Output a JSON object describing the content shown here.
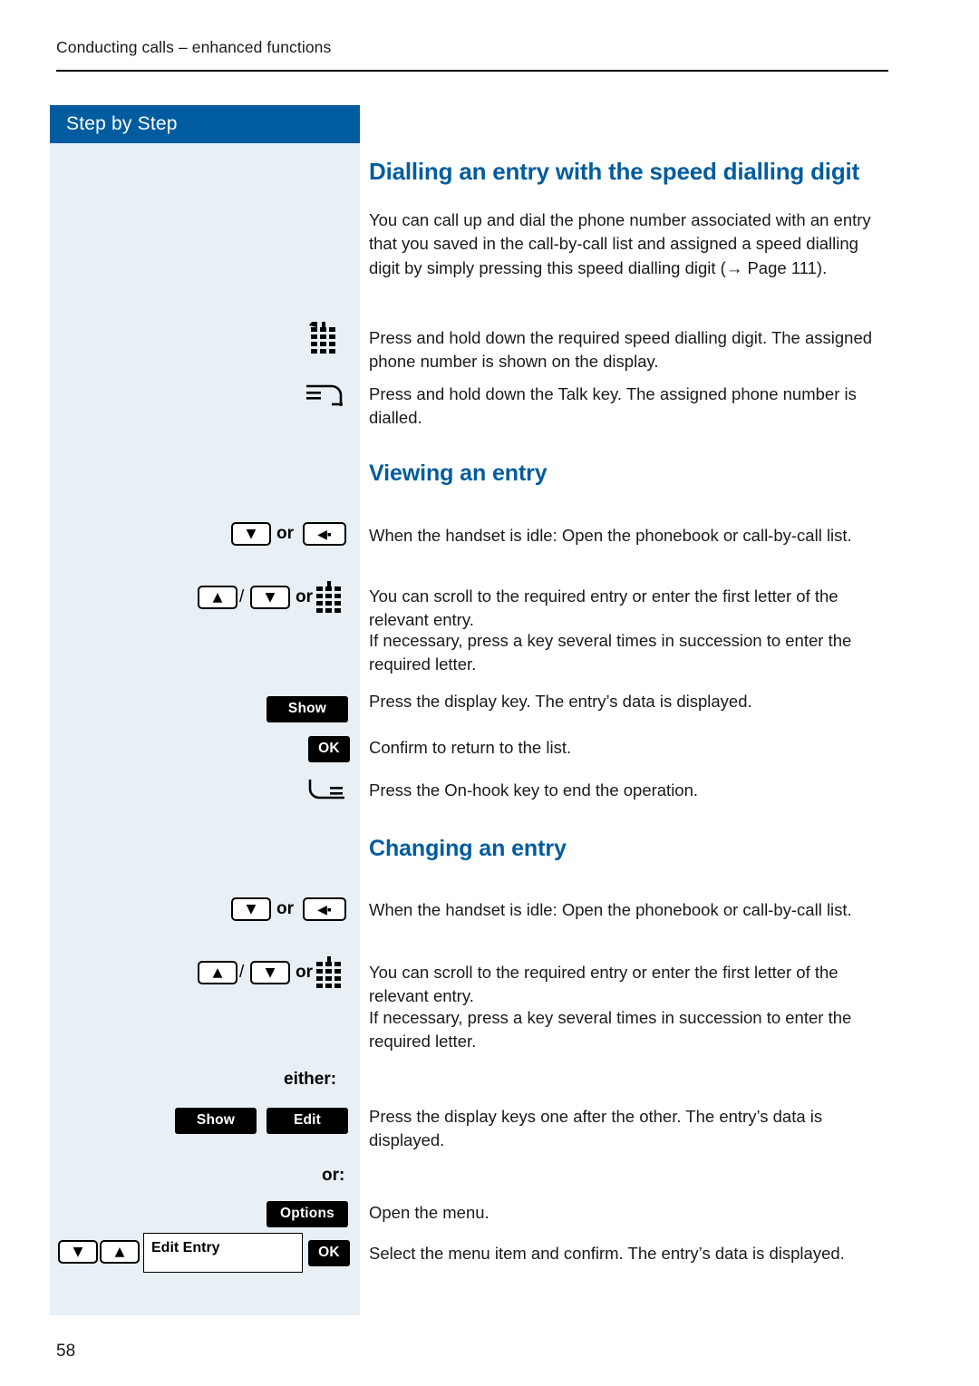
{
  "header": {
    "running_head": "Conducting calls – enhanced functions"
  },
  "sidebar": {
    "title": "Step by Step",
    "items": [
      {
        "name": "keypad-icon",
        "label": ""
      },
      {
        "name": "talk-key-icon",
        "label": ""
      },
      {
        "name": "down-key-icon",
        "label": ""
      },
      {
        "name": "or-label-1",
        "label": "or"
      },
      {
        "name": "phonebook-key-icon",
        "label": ""
      },
      {
        "name": "up-key-icon",
        "label": ""
      },
      {
        "name": "or-label-2",
        "label": "or"
      },
      {
        "name": "show-key",
        "label": "Show"
      },
      {
        "name": "ok-key",
        "label": "OK"
      },
      {
        "name": "on-hook-key-icon",
        "label": ""
      },
      {
        "name": "either-label",
        "label": "either:"
      },
      {
        "name": "edit-key",
        "label": "Edit"
      },
      {
        "name": "or-label-3",
        "label": "or:"
      },
      {
        "name": "options-key",
        "label": "Options"
      },
      {
        "name": "edit-entry-field",
        "label": "Edit Entry"
      }
    ],
    "keys": {
      "show": "Show",
      "ok": "OK",
      "edit": "Edit",
      "options": "Options",
      "edit_entry": "Edit Entry",
      "or": "or",
      "or_colon": "or:",
      "either": "either:",
      "slash": "/"
    }
  },
  "main": {
    "sections": [
      {
        "heading": "Dialling an entry with the speed dialling digit",
        "paragraphs": [
          "You can call up and dial the phone number associated with an entry that you saved in the call-by-call list and assigned a speed dialling digit by simply pressing this speed dialling digit (→ Page 111).",
          "Press and hold down the required speed dialling digit. The assigned phone number is shown on the display.",
          "Press and hold down the Talk key. The assigned phone number is dialled."
        ]
      },
      {
        "heading": "Viewing an entry",
        "paragraphs": [
          "When the handset is idle: Open the phonebook or call-by-call list.",
          "You can scroll to the required entry or enter the first letter of the relevant entry.",
          "If necessary, press a key several times in succession to enter the required letter.",
          "Press the display key. The entry’s data is displayed.",
          "Confirm to return to the list.",
          "Press the On-hook key to end the operation."
        ]
      },
      {
        "heading": "Changing an entry",
        "paragraphs": [
          "When the handset is idle: Open the phonebook or call-by-call list.",
          "You can scroll to the required entry or enter the first letter of the relevant entry.",
          "If necessary, press a key several times in succession to enter the required letter.",
          "Press the display keys one after the other. The entry’s data is displayed.",
          "Open the menu.",
          "Select the menu item and confirm. The entry’s data is displayed."
        ]
      }
    ]
  },
  "footer": {
    "page_number": "58"
  },
  "colors": {
    "accent": "#005c9e",
    "sidebar_bg": "#e8eff5",
    "key_bg": "#000000"
  }
}
